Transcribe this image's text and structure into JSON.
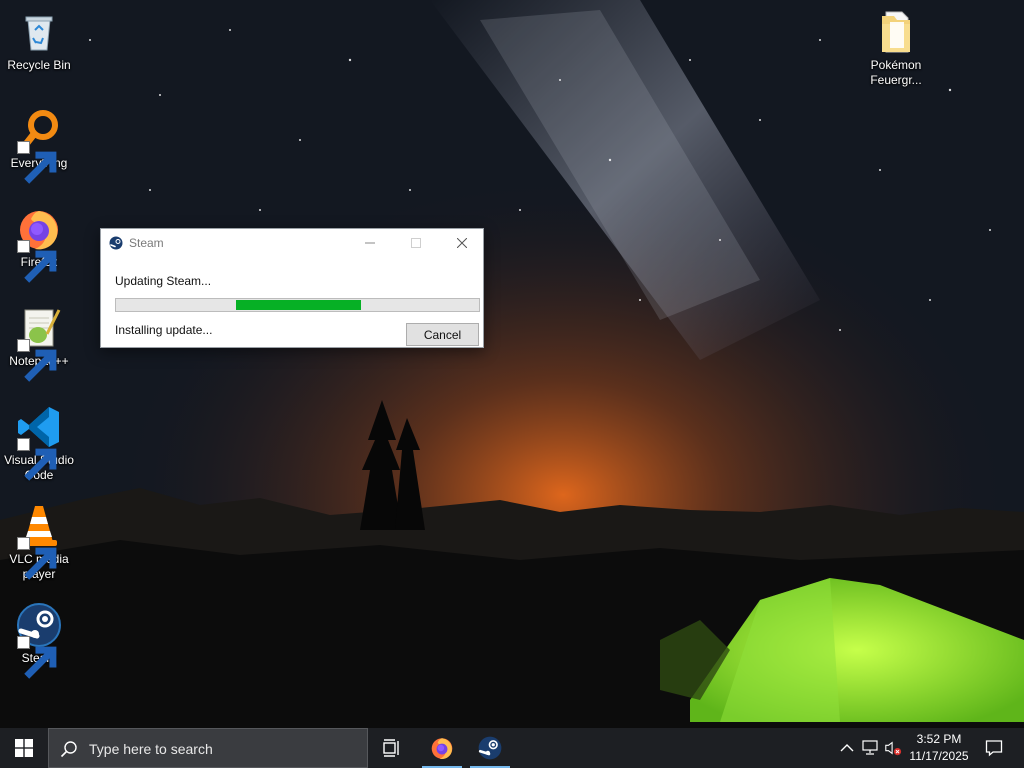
{
  "desktop": {
    "icons": [
      {
        "label": "Recycle Bin",
        "icon": "recycle-bin-icon"
      },
      {
        "label": "Everything",
        "icon": "everything-search-icon"
      },
      {
        "label": "Firefox",
        "icon": "firefox-icon"
      },
      {
        "label": "Notepad++",
        "icon": "notepad-plus-plus-icon"
      },
      {
        "label": "Visual Studio Code",
        "icon": "vscode-icon"
      },
      {
        "label": "VLC media player",
        "icon": "vlc-icon"
      },
      {
        "label": "Steam",
        "icon": "steam-icon"
      },
      {
        "label": "Pokémon Feuergr...",
        "icon": "folder-icon"
      }
    ]
  },
  "dialog": {
    "title": "Steam",
    "heading": "Updating Steam...",
    "status": "Installing update...",
    "cancel_label": "Cancel",
    "progress_segment_start_fraction": 0.33,
    "progress_segment_end_fraction": 0.675,
    "progress_color": "#06b025"
  },
  "taskbar": {
    "search_placeholder": "Type here to search",
    "pinned": [
      "task-view-icon",
      "firefox-icon",
      "steam-icon"
    ],
    "tray": [
      "chevron-up-icon",
      "network-icon",
      "volume-muted-icon"
    ],
    "time": "3:52 PM",
    "date": "11/17/2025"
  },
  "colors": {
    "accent": "#76b9ed",
    "taskbar": "#1d1f23"
  }
}
